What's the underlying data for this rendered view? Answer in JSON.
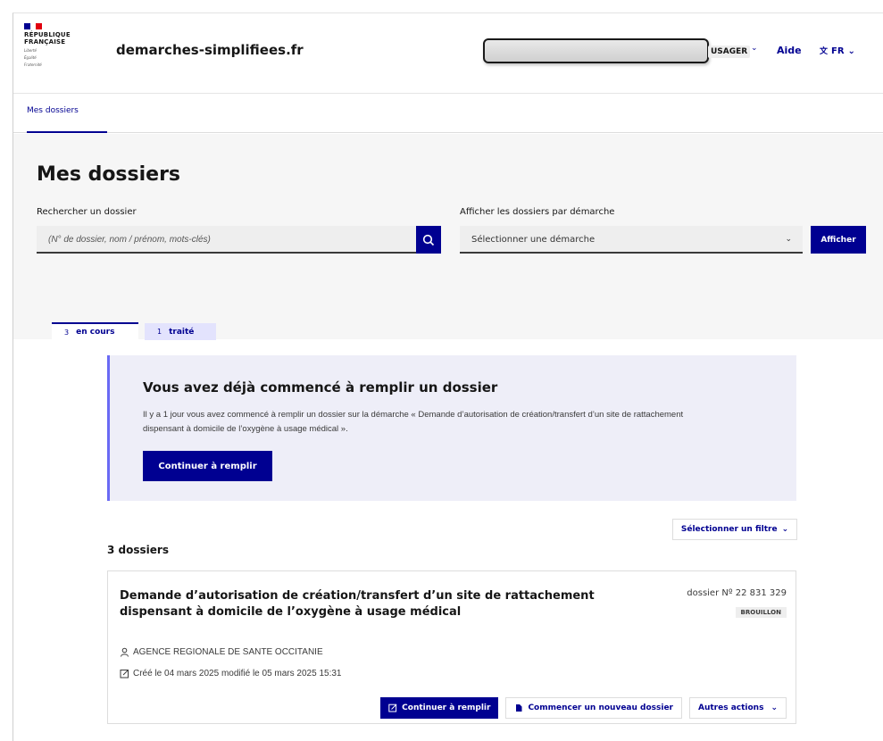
{
  "header": {
    "rf_lines": [
      "RÉPUBLIQUE",
      "FRANÇAISE"
    ],
    "devise": [
      "Liberté",
      "Égalité",
      "Fraternité"
    ],
    "site_name": "demarches-simplifiees.fr",
    "user_role": "USAGER",
    "help": "Aide",
    "lang": "FR"
  },
  "nav": {
    "tab": "Mes dossiers"
  },
  "search": {
    "page_title": "Mes dossiers",
    "search_label": "Rechercher un dossier",
    "search_placeholder": "(N° de dossier, nom / prénom, mots-clés)",
    "demarche_label": "Afficher les dossiers par démarche",
    "demarche_selected": "Sélectionner une démarche",
    "submit_label": "Afficher"
  },
  "tabs": [
    {
      "count": "3",
      "label": "en cours"
    },
    {
      "count": "1",
      "label": "traité"
    }
  ],
  "callout": {
    "title": "Vous avez déjà commencé à remplir un dossier",
    "text": "Il y a 1 jour vous avez commencé à remplir un dossier sur la démarche « Demande d’autorisation de création/transfert d’un site de rattachement dispensant à domicile de l’oxygène à usage médical ».",
    "button": "Continuer à remplir"
  },
  "list": {
    "filter_button": "Sélectionner un filtre",
    "count_title": "3 dossiers"
  },
  "card": {
    "title": "Demande d’autorisation de création/transfert d’un site de rattachement dispensant à domicile de l’oxygène à usage médical",
    "dossier_number": "dossier Nº  22 831 329",
    "status": "BROUILLON",
    "organization": "AGENCE REGIONALE DE SANTE OCCITANIE",
    "dates": "Créé le 04 mars 2025 modifié le 05 mars 2025 15:31",
    "actions": {
      "continue": "Continuer à remplir",
      "new": "Commencer un nouveau dossier",
      "other": "Autres actions"
    }
  },
  "colors": {
    "brand_blue": "#000091",
    "flag_blue": "#000091",
    "flag_red": "#e1000f"
  }
}
